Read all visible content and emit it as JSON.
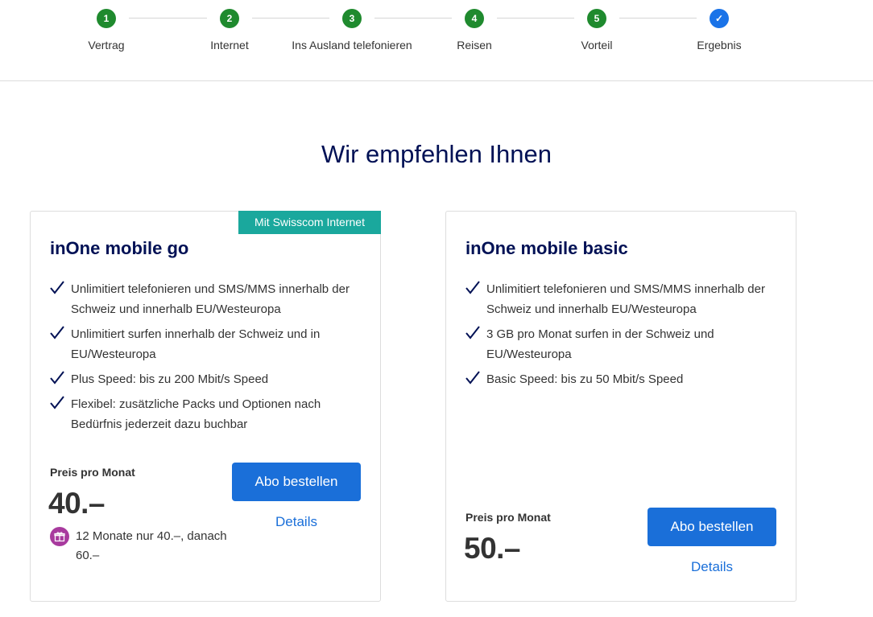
{
  "stepper": {
    "steps": [
      {
        "number": "1",
        "label": "Vertrag",
        "state": "done"
      },
      {
        "number": "2",
        "label": "Internet",
        "state": "done"
      },
      {
        "number": "3",
        "label": "Ins Ausland telefonieren",
        "state": "done"
      },
      {
        "number": "4",
        "label": "Reisen",
        "state": "done"
      },
      {
        "number": "5",
        "label": "Vorteil",
        "state": "done"
      },
      {
        "number": "✓",
        "label": "Ergebnis",
        "state": "current"
      }
    ]
  },
  "page": {
    "title": "Wir empfehlen Ihnen"
  },
  "colors": {
    "step_done": "#1f8a2e",
    "step_current": "#1a73e8",
    "badge": "#1aa89d",
    "button": "#1a6fd9",
    "title": "#001155",
    "gift": "#a83a9e"
  },
  "offers": [
    {
      "badge": "Mit Swisscom Internet",
      "title": "inOne mobile go",
      "features": [
        "Unlimitiert telefonieren und SMS/MMS innerhalb der Schweiz und innerhalb EU/Westeuropa",
        "Unlimitiert surfen innerhalb der Schweiz und in EU/Westeuropa",
        "Plus Speed: bis zu 200 Mbit/s Speed",
        "Flexibel: zusätzliche Packs und Optionen nach Bedürfnis jederzeit dazu buchbar"
      ],
      "price_label": "Preis pro Monat",
      "price": "40.–",
      "promo": "12 Monate nur 40.–, danach 60.–",
      "order_label": "Abo bestellen",
      "details_label": "Details"
    },
    {
      "title": "inOne mobile basic",
      "features": [
        "Unlimitiert telefonieren und SMS/MMS innerhalb der Schweiz und innerhalb EU/Westeuropa",
        "3 GB pro Monat surfen in der Schweiz und EU/Westeuropa",
        "Basic Speed: bis zu 50 Mbit/s Speed"
      ],
      "price_label": "Preis pro Monat",
      "price": "50.–",
      "order_label": "Abo bestellen",
      "details_label": "Details"
    }
  ]
}
